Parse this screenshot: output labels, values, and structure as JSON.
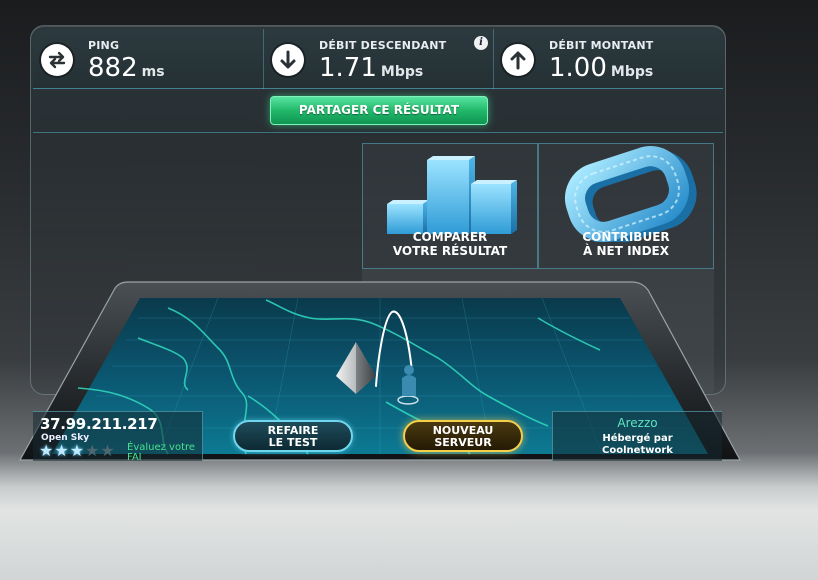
{
  "metrics": {
    "ping": {
      "label": "PING",
      "value": "882",
      "unit": "ms"
    },
    "download": {
      "label": "DÉBIT DESCENDANT",
      "value": "1.71",
      "unit": "Mbps"
    },
    "upload": {
      "label": "DÉBIT MONTANT",
      "value": "1.00",
      "unit": "Mbps"
    }
  },
  "share_label": "PARTAGER CE RÉSULTAT",
  "panels": {
    "compare": {
      "line1": "COMPARER",
      "line2": "VOTRE RÉSULTAT"
    },
    "contribute": {
      "line1": "CONTRIBUER",
      "line2": "À NET INDEX"
    }
  },
  "client": {
    "ip": "37.99.211.217",
    "isp": "Open Sky",
    "rating": 3,
    "rating_max": 5,
    "rate_line1": "Évaluez votre",
    "rate_line2": "FAI"
  },
  "buttons": {
    "retest_line1": "REFAIRE",
    "retest_line2": "LE TEST",
    "server_line1": "NOUVEAU",
    "server_line2": "SERVEUR"
  },
  "server": {
    "city": "Arezzo",
    "hosted_line1": "Hébergé par",
    "hosted_line2": "Coolnetwork"
  },
  "colors": {
    "accent": "#6fd6ee",
    "share_button": "#22b86a",
    "server_button_border": "#f5cf4a",
    "city_text": "#5ee5c2",
    "rate_text": "#47e38e"
  }
}
